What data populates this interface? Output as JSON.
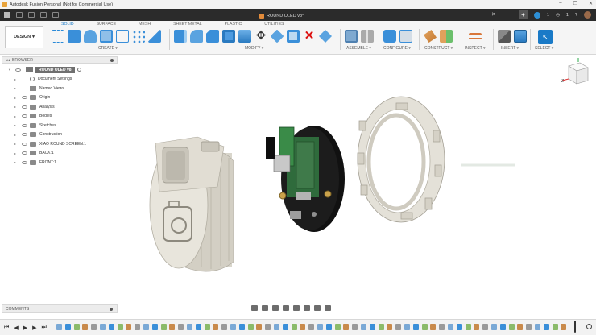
{
  "window": {
    "title": "Autodesk Fusion Personal (Not for Commercial Use)",
    "controls": [
      "–",
      "❐",
      "✕"
    ]
  },
  "tabbar": {
    "document_tab": "ROUND OLED v8*",
    "right_badges": [
      "1",
      "1"
    ]
  },
  "toolbar": {
    "workspace": "DESIGN",
    "tabs": [
      "SOLID",
      "SURFACE",
      "MESH",
      "SHEET METAL",
      "PLASTIC",
      "UTILITIES"
    ],
    "active_tab": "SOLID",
    "groups": [
      "CREATE",
      "MODIFY",
      "ASSEMBLE",
      "CONFIGURE",
      "CONSTRUCT",
      "INSPECT",
      "INSERT",
      "SELECT"
    ]
  },
  "browser": {
    "title": "BROWSER",
    "root": "ROUND OLED v8",
    "items": [
      "Document Settings",
      "Named Views",
      "Origin",
      "Analysis",
      "Bodies",
      "Sketches",
      "Construction",
      "XIAO ROUND SCREEN:1",
      "BACK:1",
      "FRONT:1"
    ]
  },
  "comments": {
    "title": "COMMENTS"
  },
  "colors": {
    "accent": "#1a7ac7",
    "tabbar_bg": "#2b2b2b",
    "model_beige": "#e6e3da",
    "pcb_green": "#3f7a4a"
  },
  "icons": [
    "apps-grid-icon",
    "search-icon",
    "gear-icon",
    "eye-icon",
    "folder-icon",
    "play-icon",
    "view-cube-icon"
  ]
}
